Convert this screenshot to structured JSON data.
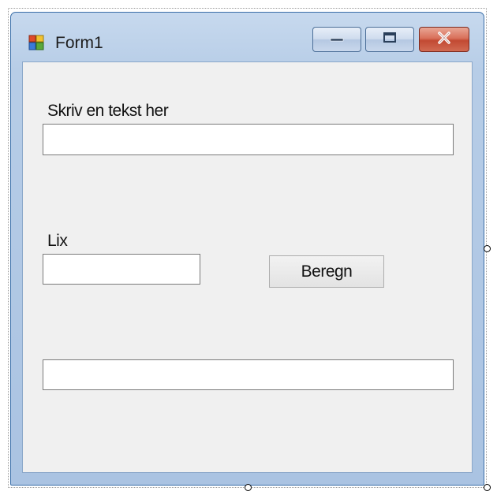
{
  "window": {
    "title": "Form1",
    "controls": {
      "minimize_icon": "minimize-icon",
      "maximize_icon": "maximize-icon",
      "close_icon": "close-icon"
    }
  },
  "form": {
    "text_label": "Skriv en tekst her",
    "text_value": "",
    "lix_label": "Lix",
    "lix_value": "",
    "calculate_button": "Beregn",
    "result_value": ""
  },
  "colors": {
    "titlebar": "#b7cde7",
    "client": "#f0f0f0",
    "close_button": "#c24a33"
  }
}
